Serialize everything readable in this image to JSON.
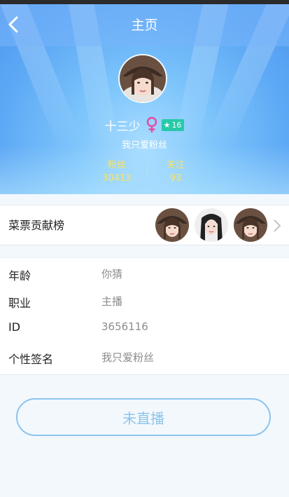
{
  "header": {
    "title": "主页",
    "back_icon": "chevron-left-icon"
  },
  "profile": {
    "nickname": "十三少",
    "gender_icon": "female-icon",
    "gender_color": "#e64aa0",
    "level": "16",
    "level_icon": "star-icon",
    "level_color": "#27c9a8",
    "signature": "我只爱粉丝",
    "stats": {
      "fans_label": "粉丝",
      "fans_value": "30413",
      "follow_label": "关注",
      "follow_value": "93"
    }
  },
  "contribution": {
    "label": "菜票贡献榜",
    "avatars": [
      "avatar-1",
      "avatar-2",
      "avatar-3"
    ],
    "chevron_icon": "chevron-right-icon"
  },
  "info": [
    {
      "key": "年龄",
      "value": "你猜"
    },
    {
      "key": "职业",
      "value": "主播"
    },
    {
      "key": "ID",
      "value": "3656116"
    },
    {
      "key": "个性签名",
      "value": "我只爱粉丝"
    }
  ],
  "action": {
    "live_label": "未直播"
  },
  "colors": {
    "accent": "#8cc4ec",
    "stat_yellow": "#ffe25a",
    "header_blue": "#5ea9f5"
  }
}
